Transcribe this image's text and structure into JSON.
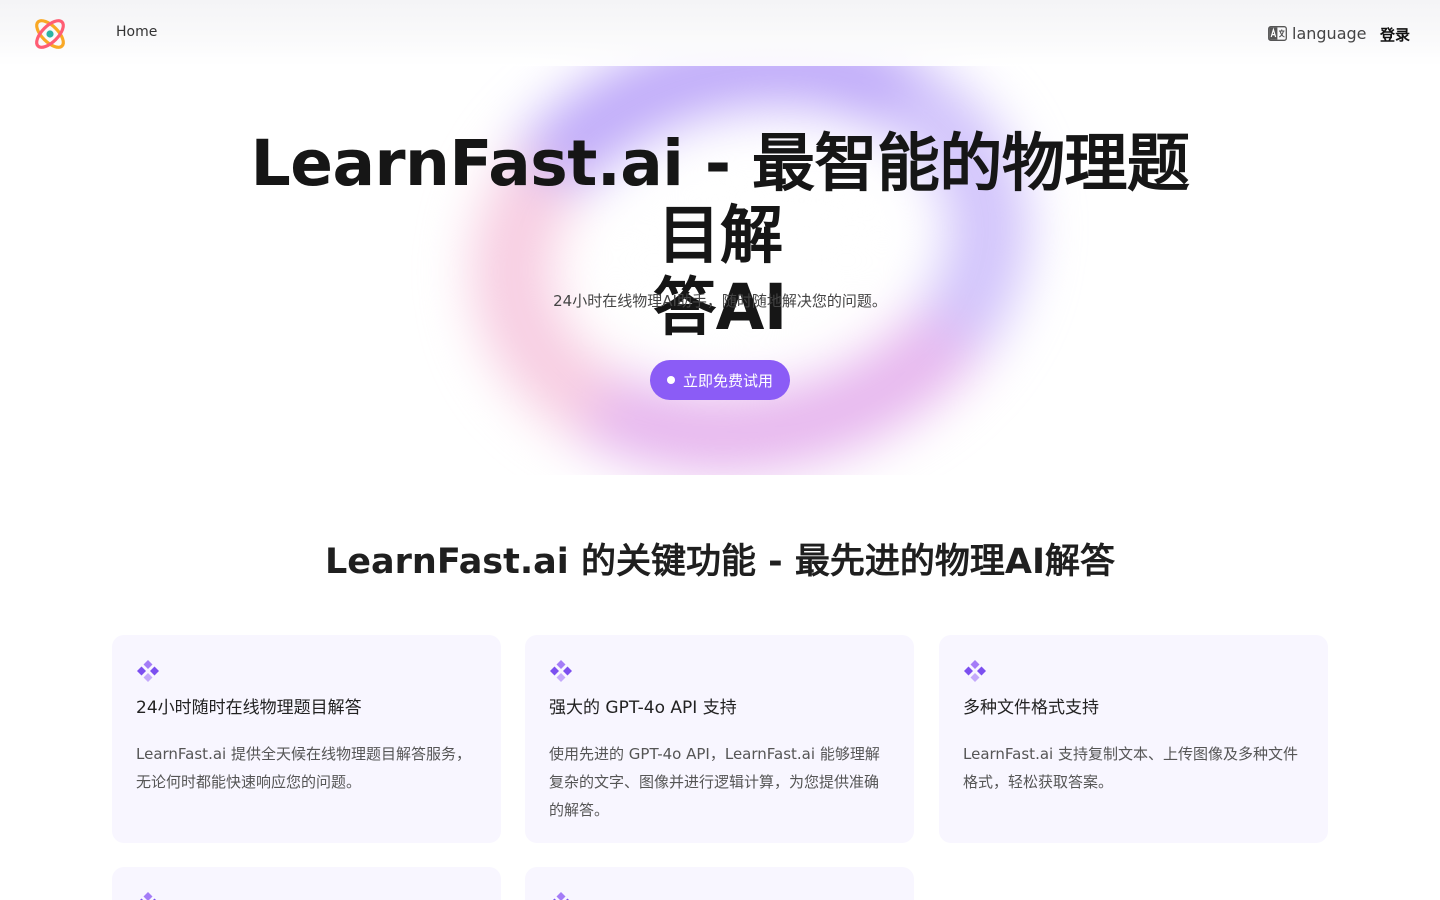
{
  "nav": {
    "home_label": "Home",
    "language_label": "language",
    "login_label": "登录"
  },
  "hero": {
    "title_line1": "LearnFast.ai - 最智能的物理题目解",
    "title_line2": "答AI",
    "subtitle": "24小时在线物理AI助手，随时随地解决您的问题。",
    "cta_label": "立即免费试用"
  },
  "features": {
    "title": "LearnFast.ai 的关键功能 - 最先进的物理AI解答",
    "cards": [
      {
        "title": "24小时随时在线物理题目解答",
        "desc": "LearnFast.ai 提供全天候在线物理题目解答服务，无论何时都能快速响应您的问题。"
      },
      {
        "title": "强大的 GPT-4o API 支持",
        "desc": "使用先进的 GPT-4o API，LearnFast.ai 能够理解复杂的文字、图像并进行逻辑计算，为您提供准确的解答。"
      },
      {
        "title": "多种文件格式支持",
        "desc": "LearnFast.ai 支持复制文本、上传图像及多种文件格式，轻松获取答案。"
      }
    ]
  },
  "colors": {
    "accent": "#8b5cf6",
    "card_bg": "#f8f6ff",
    "gem": "#9b6cf5"
  },
  "icons": {
    "logo": "atom-logo-icon",
    "language": "translate-icon",
    "card": "diamond-cluster-icon"
  }
}
